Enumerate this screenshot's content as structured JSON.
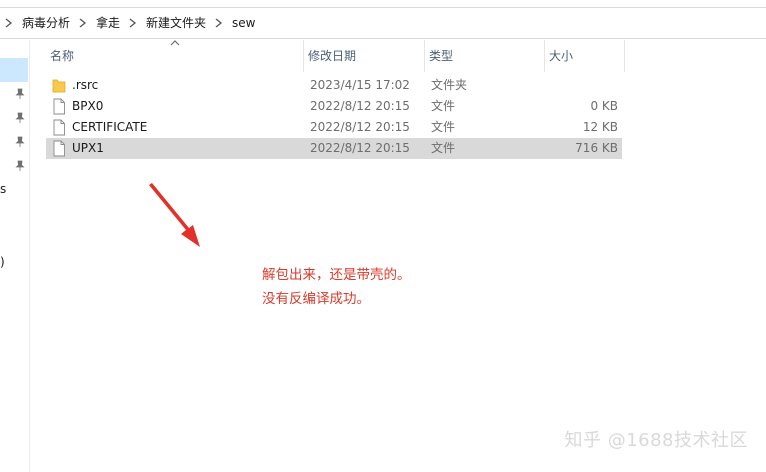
{
  "breadcrumb": [
    "病毒分析",
    "拿走",
    "新建文件夹",
    "sew"
  ],
  "nav": {
    "fragments": [
      "s",
      ")"
    ]
  },
  "columns": {
    "name": "名称",
    "date": "修改日期",
    "type": "类型",
    "size": "大小"
  },
  "files": [
    {
      "name": ".rsrc",
      "date": "2023/4/15 17:02",
      "type": "文件夹",
      "size": "",
      "icon": "folder-icon"
    },
    {
      "name": "BPX0",
      "date": "2022/8/12 20:15",
      "type": "文件",
      "size": "0 KB",
      "icon": "file-icon"
    },
    {
      "name": "CERTIFICATE",
      "date": "2022/8/12 20:15",
      "type": "文件",
      "size": "12 KB",
      "icon": "file-icon"
    },
    {
      "name": "UPX1",
      "date": "2022/8/12 20:15",
      "type": "文件",
      "size": "716 KB",
      "icon": "file-icon",
      "selected": true
    }
  ],
  "annotation": {
    "line1": "解包出来，还是带壳的。",
    "line2": "没有反编译成功。",
    "color": "#d93a2b"
  },
  "watermark": "知乎 @1688技术社区",
  "colors": {
    "selection": "#d9d9d9",
    "nav_selection": "#cce8ff",
    "folder": "#f8c94b",
    "header_text": "#4c607a"
  }
}
